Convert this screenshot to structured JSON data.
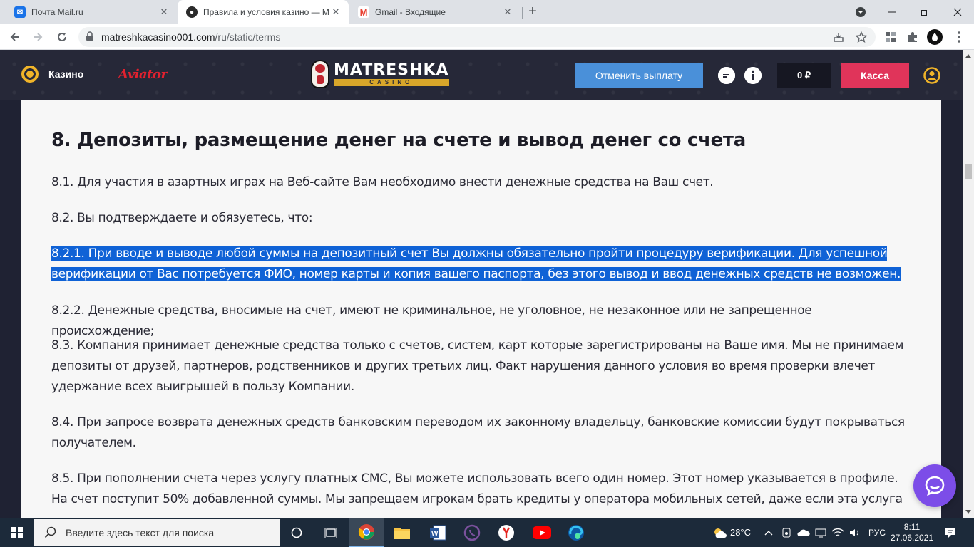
{
  "browser": {
    "tabs": [
      {
        "title": "Почта Mail.ru",
        "favicon": "mail-ru-icon",
        "active": false
      },
      {
        "title": "Правила и условия казино — M",
        "favicon": "matreshka-icon",
        "active": true
      },
      {
        "title": "Gmail - Входящие",
        "favicon": "gmail-icon",
        "active": false
      }
    ],
    "new_tab": "+",
    "url_domain": "matreshkacasino001.com",
    "url_path": "/ru/static/terms"
  },
  "site": {
    "nav_casino": "Казино",
    "nav_aviator": "Aviator",
    "logo_name": "MATRESHKA",
    "logo_sub": "CASINO",
    "cancel_payout": "Отменить выплату",
    "balance": "0 ₽",
    "cashier": "Касса"
  },
  "content": {
    "heading": "8. Депозиты, размещение денег на счете и вывод денег со счета",
    "paragraphs": {
      "p1": "8.1. Для участия в азартных играх на Веб-сайте Вам необходимо внести денежные средства на Ваш счет.",
      "p2": "8.2. Вы подтверждаете и обязуетесь, что:",
      "p3a": "8.2.1. При вводе и выводе любой суммы на депозитный счет Вы должны обязательно пройти процедуру верификации. Для успешной",
      "p3b": "верификации от Вас потребуется ФИО, номер карты и копия вашего паспорта, без этого вывод и ввод денежных средств не возможен.",
      "p4": "8.2.2. Денежные средства, вносимые на счет, имеют не криминальное, не уголовное, не незаконное или не запрещенное происхождение;",
      "p5": "8.3. Компания принимает денежные средства только с счетов, систем, карт которые зарегистрированы на Ваше имя. Мы не принимаем депозиты от друзей, партнеров, родственников и других третьих лиц. Факт нарушения данного условия во время проверки влечет удержание всех выигрышей в пользу Компании.",
      "p6": "8.4. При запросе возврата денежных средств банковским переводом их законному владельцу, банковские комиссии будут покрываться получателем.",
      "p7": "8.5. При пополнении счета через услугу платных СМС, Вы можете использовать всего один номер. Этот номер указывается в профиле. На счет поступит 50% добавленной суммы. Мы запрещаем игрокам брать кредиты у оператора мобильных сетей, даже если эта услуга"
    }
  },
  "taskbar": {
    "search_placeholder": "Введите здесь текст для поиска",
    "weather": "28°C",
    "language": "РУС",
    "time": "8:11",
    "date": "27.06.2021"
  },
  "colors": {
    "header_bg": "#262838",
    "cancel_btn": "#4a90d9",
    "cashier_btn": "#e0345a",
    "selection": "#0f62d6",
    "chat": "#7c4de8"
  }
}
